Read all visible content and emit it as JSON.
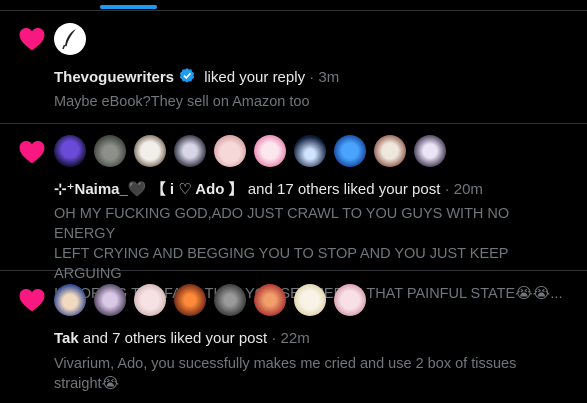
{
  "colors": {
    "accent": "#1d9bf0",
    "heart": "#f91880",
    "muted": "#71767b",
    "text": "#e7e9ea",
    "border": "#2f3336"
  },
  "notifications": [
    {
      "icon": "heart-icon",
      "avatars": [
        "quill-logo-avatar"
      ],
      "actor": "Thevoguewriters",
      "verified": true,
      "action": " liked your reply",
      "time": " · 3m",
      "snippet": "Maybe eBook?They sell on Amazon too"
    },
    {
      "icon": "heart-icon",
      "avatars": [
        "avatar-1",
        "avatar-2",
        "avatar-3",
        "avatar-4",
        "avatar-5",
        "avatar-6",
        "avatar-7",
        "avatar-8",
        "avatar-9",
        "avatar-10"
      ],
      "actor": "⊹⁺Naima_",
      "actor_heart": "🖤",
      "actor_suffix": " 【 i ♡ Ado 】",
      "action": " and 17 others liked your post",
      "time": " · 20m",
      "snippet_lines": [
        "OH MY FUCKING GOD,ADO JUST CRAWL TO YOU GUYS WITH NO ENERGY",
        "LEFT CRYING AND BEGGING YOU TO STOP AND YOU JUST KEEP ARGUING",
        "IGNORING THE FACT THAT YOU SEE HER IN THAT PAINFUL STATE"
      ],
      "snippet_tail": "😭😭...",
      "more": "..."
    },
    {
      "icon": "heart-icon",
      "avatars": [
        "avatar-1",
        "avatar-2",
        "avatar-3",
        "avatar-4",
        "avatar-5",
        "avatar-6",
        "avatar-7",
        "avatar-8"
      ],
      "actor": "Tak",
      "action": " and 7 others liked your post",
      "time": " · 22m",
      "snippet_lines": [
        "Vivarium, Ado, you sucessfully makes me cried and use 2 box of tissues",
        "straight"
      ],
      "snippet_tail": "😭"
    }
  ]
}
